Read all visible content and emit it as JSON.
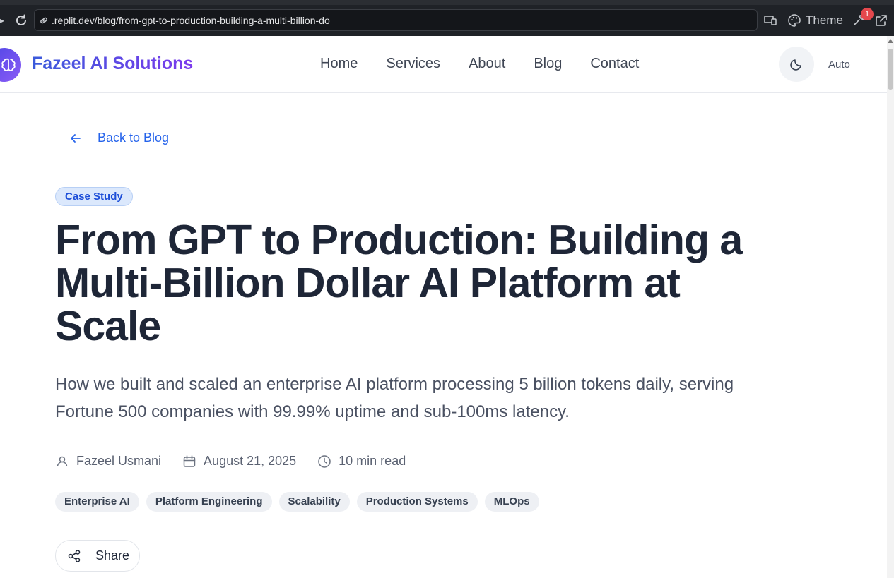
{
  "browser": {
    "url": ".replit.dev/blog/from-gpt-to-production-building-a-multi-billion-do",
    "theme_label": "Theme",
    "badge_count": "1"
  },
  "site": {
    "brand": "Fazeel AI Solutions",
    "nav": [
      "Home",
      "Services",
      "About",
      "Blog",
      "Contact"
    ],
    "theme_mode": "Auto"
  },
  "article": {
    "back_label": "Back to Blog",
    "category": "Case Study",
    "title": "From GPT to Production: Building a Multi-Billion Dollar AI Platform at Scale",
    "subtitle": "How we built and scaled an enterprise AI platform processing 5 billion tokens daily, serving Fortune 500 companies with 99.99% uptime and sub-100ms latency.",
    "author": "Fazeel Usmani",
    "date": "August 21, 2025",
    "read_time": "10 min read",
    "tags": [
      "Enterprise AI",
      "Platform Engineering",
      "Scalability",
      "Production Systems",
      "MLOps"
    ],
    "share_label": "Share"
  },
  "colors": {
    "accent": "#2563eb",
    "brand_gradient_start": "#3b5bdb",
    "brand_gradient_end": "#7c3aed",
    "title": "#1e2637"
  }
}
